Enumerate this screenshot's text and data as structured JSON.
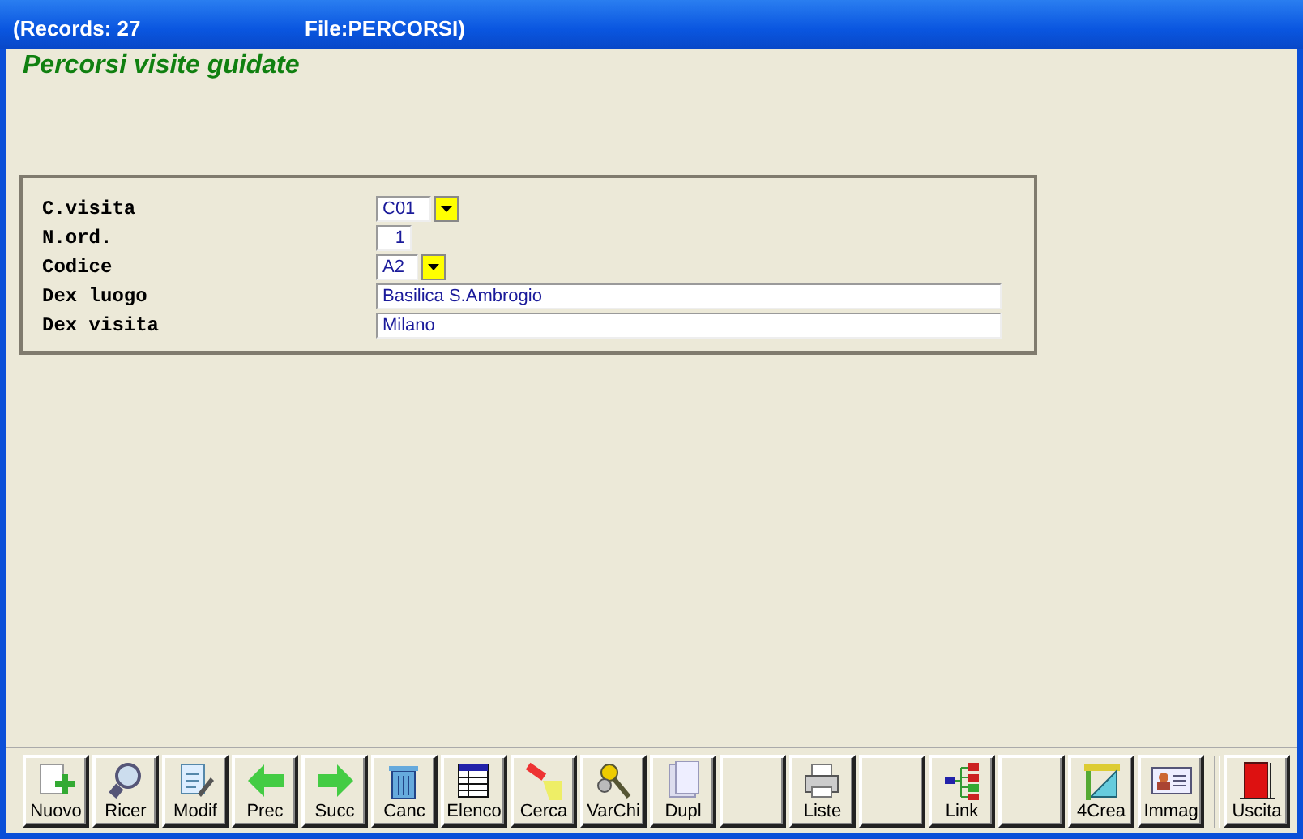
{
  "window": {
    "records": "(Records: 27",
    "file": "File:PERCORSI)"
  },
  "heading": "Percorsi visite guidate",
  "form": {
    "rows": [
      {
        "label": "C.visita",
        "kind": "combo",
        "value": "C01"
      },
      {
        "label": "N.ord.",
        "kind": "number",
        "value": "1"
      },
      {
        "label": "Codice",
        "kind": "combo_small",
        "value": "A2"
      },
      {
        "label": "Dex luogo",
        "kind": "wide",
        "value": "Basilica S.Ambrogio"
      },
      {
        "label": "Dex visita",
        "kind": "wide",
        "value": "Milano"
      }
    ]
  },
  "toolbar": {
    "buttons": [
      {
        "kind": "new",
        "label": "Nuovo"
      },
      {
        "kind": "search",
        "label": "Ricer"
      },
      {
        "kind": "edit",
        "label": "Modif"
      },
      {
        "kind": "prev",
        "label": "Prec"
      },
      {
        "kind": "next",
        "label": "Succ"
      },
      {
        "kind": "delete",
        "label": "Canc"
      },
      {
        "kind": "list",
        "label": "Elenco"
      },
      {
        "kind": "find",
        "label": "Cerca"
      },
      {
        "kind": "keys",
        "label": "VarChi"
      },
      {
        "kind": "copy",
        "label": "Dupl"
      },
      {
        "kind": "blank"
      },
      {
        "kind": "print",
        "label": "Liste"
      },
      {
        "kind": "blank"
      },
      {
        "kind": "link",
        "label": "Link"
      },
      {
        "kind": "blank"
      },
      {
        "kind": "tools",
        "label": "4Crea"
      },
      {
        "kind": "card",
        "label": "Immag"
      },
      {
        "kind": "exit",
        "label": "Uscita"
      }
    ]
  }
}
